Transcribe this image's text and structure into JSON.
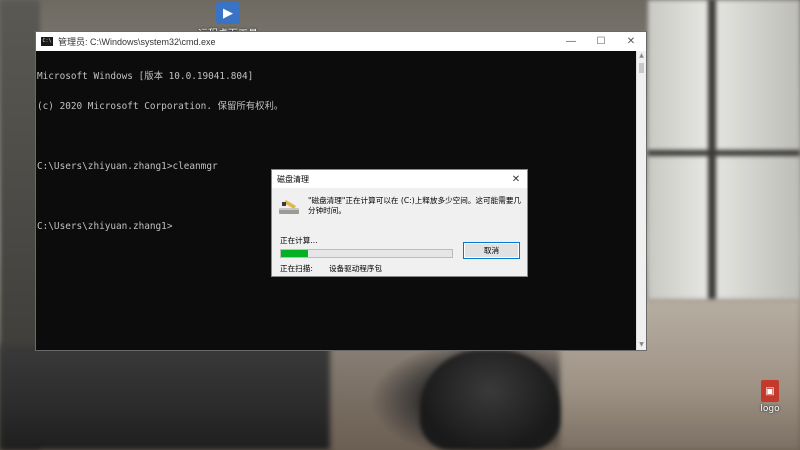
{
  "desktop": {
    "top_icon_label": "远程桌面工具",
    "logo_icon_label": "logo"
  },
  "cmd": {
    "title": "管理员: C:\\Windows\\system32\\cmd.exe",
    "app_icon_text": "C:\\",
    "lines": [
      "Microsoft Windows [版本 10.0.19041.804]",
      "(c) 2020 Microsoft Corporation. 保留所有权利。",
      "",
      "C:\\Users\\zhiyuan.zhang1>cleanmgr",
      "",
      "C:\\Users\\zhiyuan.zhang1>"
    ]
  },
  "dialog": {
    "title": "磁盘清理",
    "message": "\"磁盘清理\"正在计算可以在 (C:)上释放多少空间。这可能需要几分钟时间。",
    "calculating": "正在计算...",
    "progress_percent": 16,
    "cancel_label": "取消",
    "scanning_label": "正在扫描:",
    "scanning_item": "设备驱动程序包"
  },
  "colors": {
    "progress_fill": "#06b025",
    "console_bg": "#0c0c0c",
    "console_text": "#c0c0c0",
    "button_focus": "#0078d7"
  }
}
